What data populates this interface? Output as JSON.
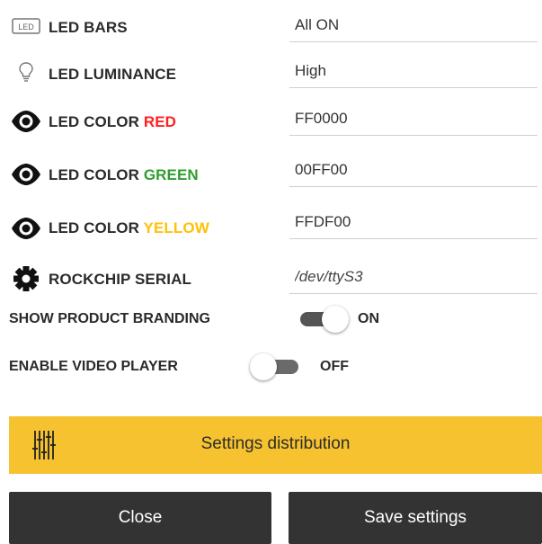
{
  "settings": [
    {
      "key": "led_bars",
      "icon": "led-badge-icon",
      "label": "LED BARS",
      "accent": "",
      "accent_color": "",
      "value": "All ON"
    },
    {
      "key": "led_luminance",
      "icon": "lightbulb-icon",
      "label": "LED LUMINANCE",
      "accent": "",
      "accent_color": "",
      "value": "High"
    },
    {
      "key": "led_color_red",
      "icon": "eye-icon",
      "label": "LED COLOR ",
      "accent": "RED",
      "accent_color": "#ff2020",
      "value": "FF0000"
    },
    {
      "key": "led_color_green",
      "icon": "eye-icon",
      "label": "LED COLOR ",
      "accent": "GREEN",
      "accent_color": "#2e9e2e",
      "value": "00FF00"
    },
    {
      "key": "led_color_yellow",
      "icon": "eye-icon",
      "label": "LED COLOR ",
      "accent": "YELLOW",
      "accent_color": "#ffc107",
      "value": "FFDF00"
    },
    {
      "key": "rockchip_serial",
      "icon": "gear-icon",
      "label": "ROCKCHIP SERIAL",
      "accent": "",
      "accent_color": "",
      "value": "/dev/ttyS3"
    }
  ],
  "toggles": {
    "branding": {
      "label": "SHOW PRODUCT BRANDING",
      "state": "ON",
      "on": true
    },
    "video": {
      "label": "ENABLE VIDEO PLAYER",
      "state": "OFF",
      "on": false
    }
  },
  "distribution": {
    "label": "Settings distribution",
    "icon": "sliders-icon",
    "color": "#f6c22f"
  },
  "buttons": {
    "close": "Close",
    "save": "Save settings"
  },
  "colors": {
    "switch_on_track": "#555555",
    "switch_off_track": "#6a6a6a",
    "button_bg": "#333333"
  }
}
